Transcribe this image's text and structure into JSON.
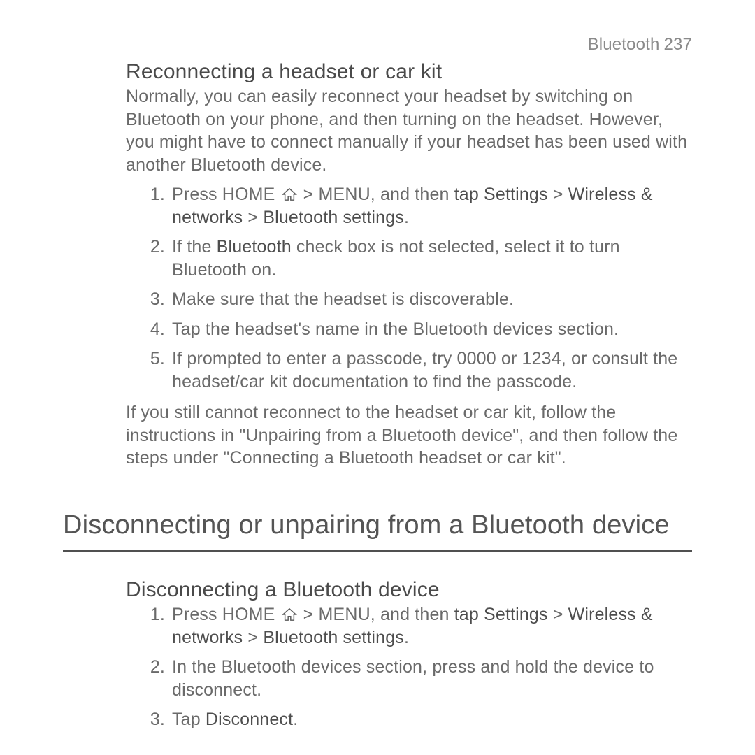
{
  "header": {
    "section": "Bluetooth",
    "page": "237"
  },
  "reconnect": {
    "heading": "Reconnecting a headset or car kit",
    "intro": "Normally, you can easily reconnect your headset by switching on Bluetooth on your phone, and then turning on the headset. However, you might have to connect manually if your headset has been used with another Bluetooth device.",
    "steps": {
      "s1a": "Press HOME ",
      "s1b": " > MENU, and then ",
      "s1c": "tap",
      "s1d": " ",
      "s1e": "Settings",
      "s1f": " > ",
      "s1g": "Wireless & networks",
      "s1h": " > ",
      "s1i": "Bluetooth settings",
      "s1j": ".",
      "s2a": "If the ",
      "s2b": "Bluetooth",
      "s2c": " check box is not selected, select it to turn Bluetooth on.",
      "s3": "Make sure that the headset is discoverable.",
      "s4": "Tap the headset's name in the Bluetooth devices section.",
      "s5": "If prompted to enter a passcode, try 0000 or 1234, or consult the headset/car kit documentation to find the passcode."
    },
    "outro": "If you still cannot reconnect to the headset or car kit, follow the instructions in \"Unpairing from a Bluetooth device\", and then follow the steps under \"Connecting a Bluetooth headset or car kit\"."
  },
  "section2": {
    "heading": "Disconnecting or unpairing from a Bluetooth device"
  },
  "disconnect": {
    "heading": "Disconnecting a Bluetooth device",
    "steps": {
      "s1a": "Press HOME ",
      "s1b": " > MENU, and then ",
      "s1c": "tap",
      "s1d": " ",
      "s1e": "Settings",
      "s1f": " > ",
      "s1g": "Wireless & networks",
      "s1h": " > ",
      "s1i": "Bluetooth settings",
      "s1j": ".",
      "s2": "In the Bluetooth devices section, press and hold the device to disconnect.",
      "s3a": "Tap ",
      "s3b": "Disconnect",
      "s3c": "."
    }
  }
}
